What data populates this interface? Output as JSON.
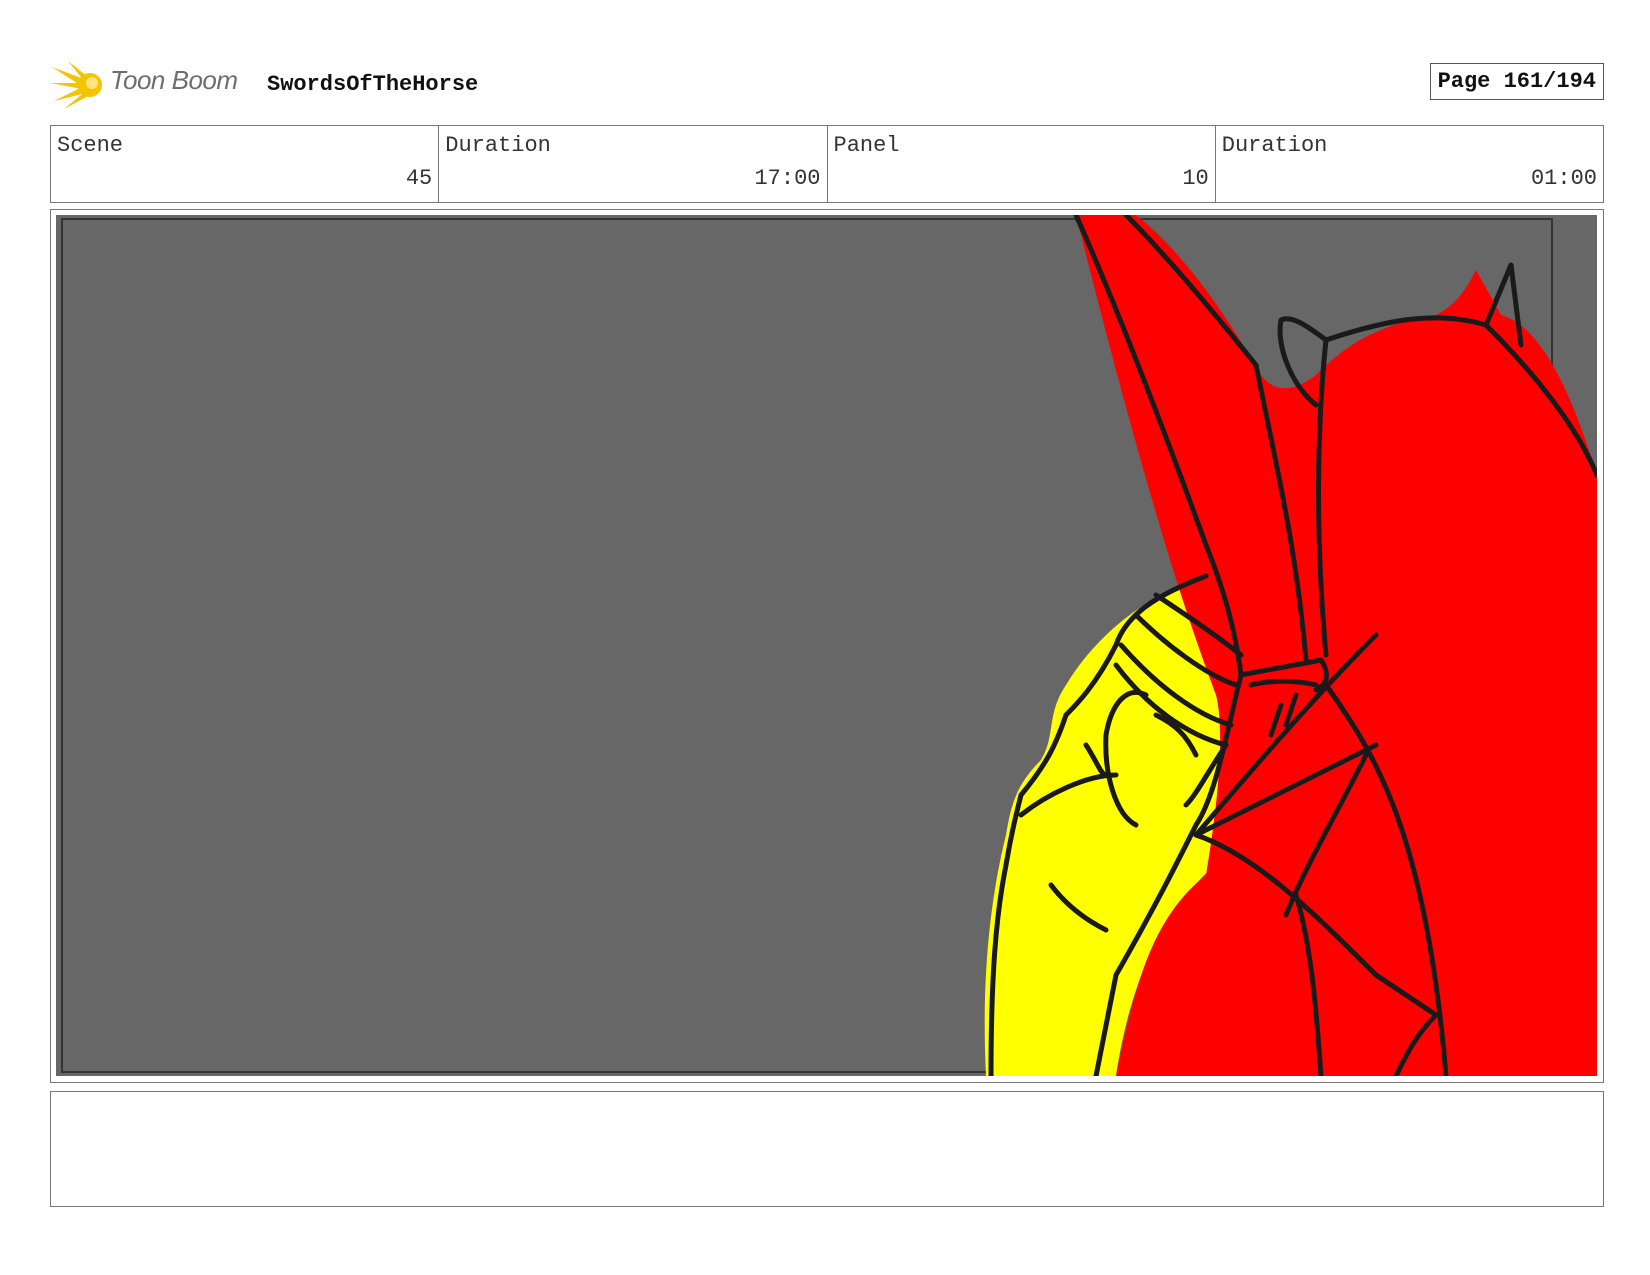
{
  "header": {
    "brand": "Toon Boom",
    "project_title": "SwordsOfTheHorse",
    "page_label": "Page 161/194"
  },
  "info": {
    "scene_label": "Scene",
    "scene_value": "45",
    "scene_duration_label": "Duration",
    "scene_duration_value": "17:00",
    "panel_label": "Panel",
    "panel_value": "10",
    "panel_duration_label": "Duration",
    "panel_duration_value": "01:00"
  },
  "colors": {
    "background_gray": "#676767",
    "red_figure": "#ff0000",
    "yellow_figure": "#ffff00",
    "line": "#1a1a1a",
    "logo_yellow": "#f5c400"
  },
  "notes": {
    "text": ""
  }
}
